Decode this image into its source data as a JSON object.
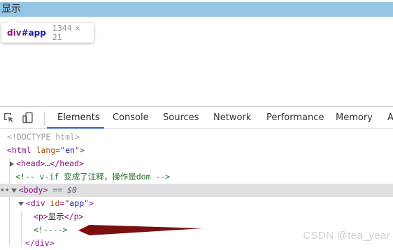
{
  "page": {
    "app_text": "显示",
    "tooltip": {
      "tag": "div",
      "id": "#app",
      "size": "1344 × 21"
    }
  },
  "devtools": {
    "icons": [
      "inspect-cursor-icon",
      "device-toggle-icon"
    ],
    "tabs": [
      {
        "label": "Elements",
        "active": true
      },
      {
        "label": "Console"
      },
      {
        "label": "Sources"
      },
      {
        "label": "Network"
      },
      {
        "label": "Performance"
      },
      {
        "label": "Memory"
      },
      {
        "label": "A"
      }
    ],
    "dom": {
      "doctype": "<!DOCTYPE html>",
      "html_open": "<html ",
      "html_attr": "lang",
      "html_eq": "=\"",
      "html_val": "en",
      "html_close": "\">",
      "head": "<head>…</head>",
      "comment": "<!-- v-if 变成了注释，操作是dom -->",
      "body": "<body>",
      "body_eq": " == $0",
      "div_open": "<div ",
      "div_attr": "id",
      "div_eq": "=\"",
      "div_val": "app",
      "div_close": "\">",
      "p_open": "<p>",
      "p_text": "显示",
      "p_close": "</p>",
      "empty_comment": "<!---->",
      "div_end": "</div>",
      "dots": "••"
    }
  },
  "watermark": "CSDN @tea_year",
  "colors": {
    "highlight": "#95c6e6",
    "tag": "#881280",
    "attr": "#994500",
    "value": "#1a1aa6",
    "comment": "#236e25",
    "active_tab_underline": "#1a73e8",
    "arrow": "#7a0f0f"
  }
}
